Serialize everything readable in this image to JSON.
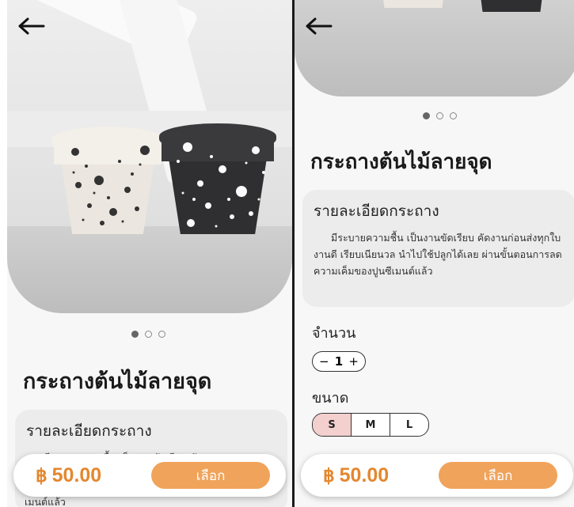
{
  "left": {
    "title": "กระถางต้นไม้ลายจุด",
    "details_heading": "รายละเอียดกระถาง",
    "details_partial": "มีระบายความชื้น เป็นงานขัดเรียบ คัดงาน",
    "cutoff_text": "เมนต์แล้ว",
    "carousel": {
      "count": 3,
      "active": 0
    },
    "price": "50.00",
    "currency": "฿",
    "select_label": "เลือก"
  },
  "right": {
    "title": "กระถางต้นไม้ลายจุด",
    "details_heading": "รายละเอียดกระถาง",
    "details_text": "มีระบายความชื้น เป็นงานขัดเรียบ คัดงานก่อนส่งทุกใบ งานดี เรียบเนียนวล  นำไปใช้ปลูกได้เลย ผ่านขั้นตอนการลดความเค็มของปูนซีเมนต์แล้ว",
    "quantity_label": "จำนวน",
    "quantity": "1",
    "minus": "−",
    "plus": "+",
    "size_label": "ขนาด",
    "sizes": [
      "S",
      "M",
      "L"
    ],
    "selected_size": "S",
    "price": "50.00",
    "currency": "฿",
    "select_label": "เลือก"
  },
  "colors": {
    "accent": "#f0a35a",
    "price": "#e4872e",
    "selected_size": "#f3cfcd"
  },
  "icons": {
    "back": "arrow-left-icon"
  }
}
